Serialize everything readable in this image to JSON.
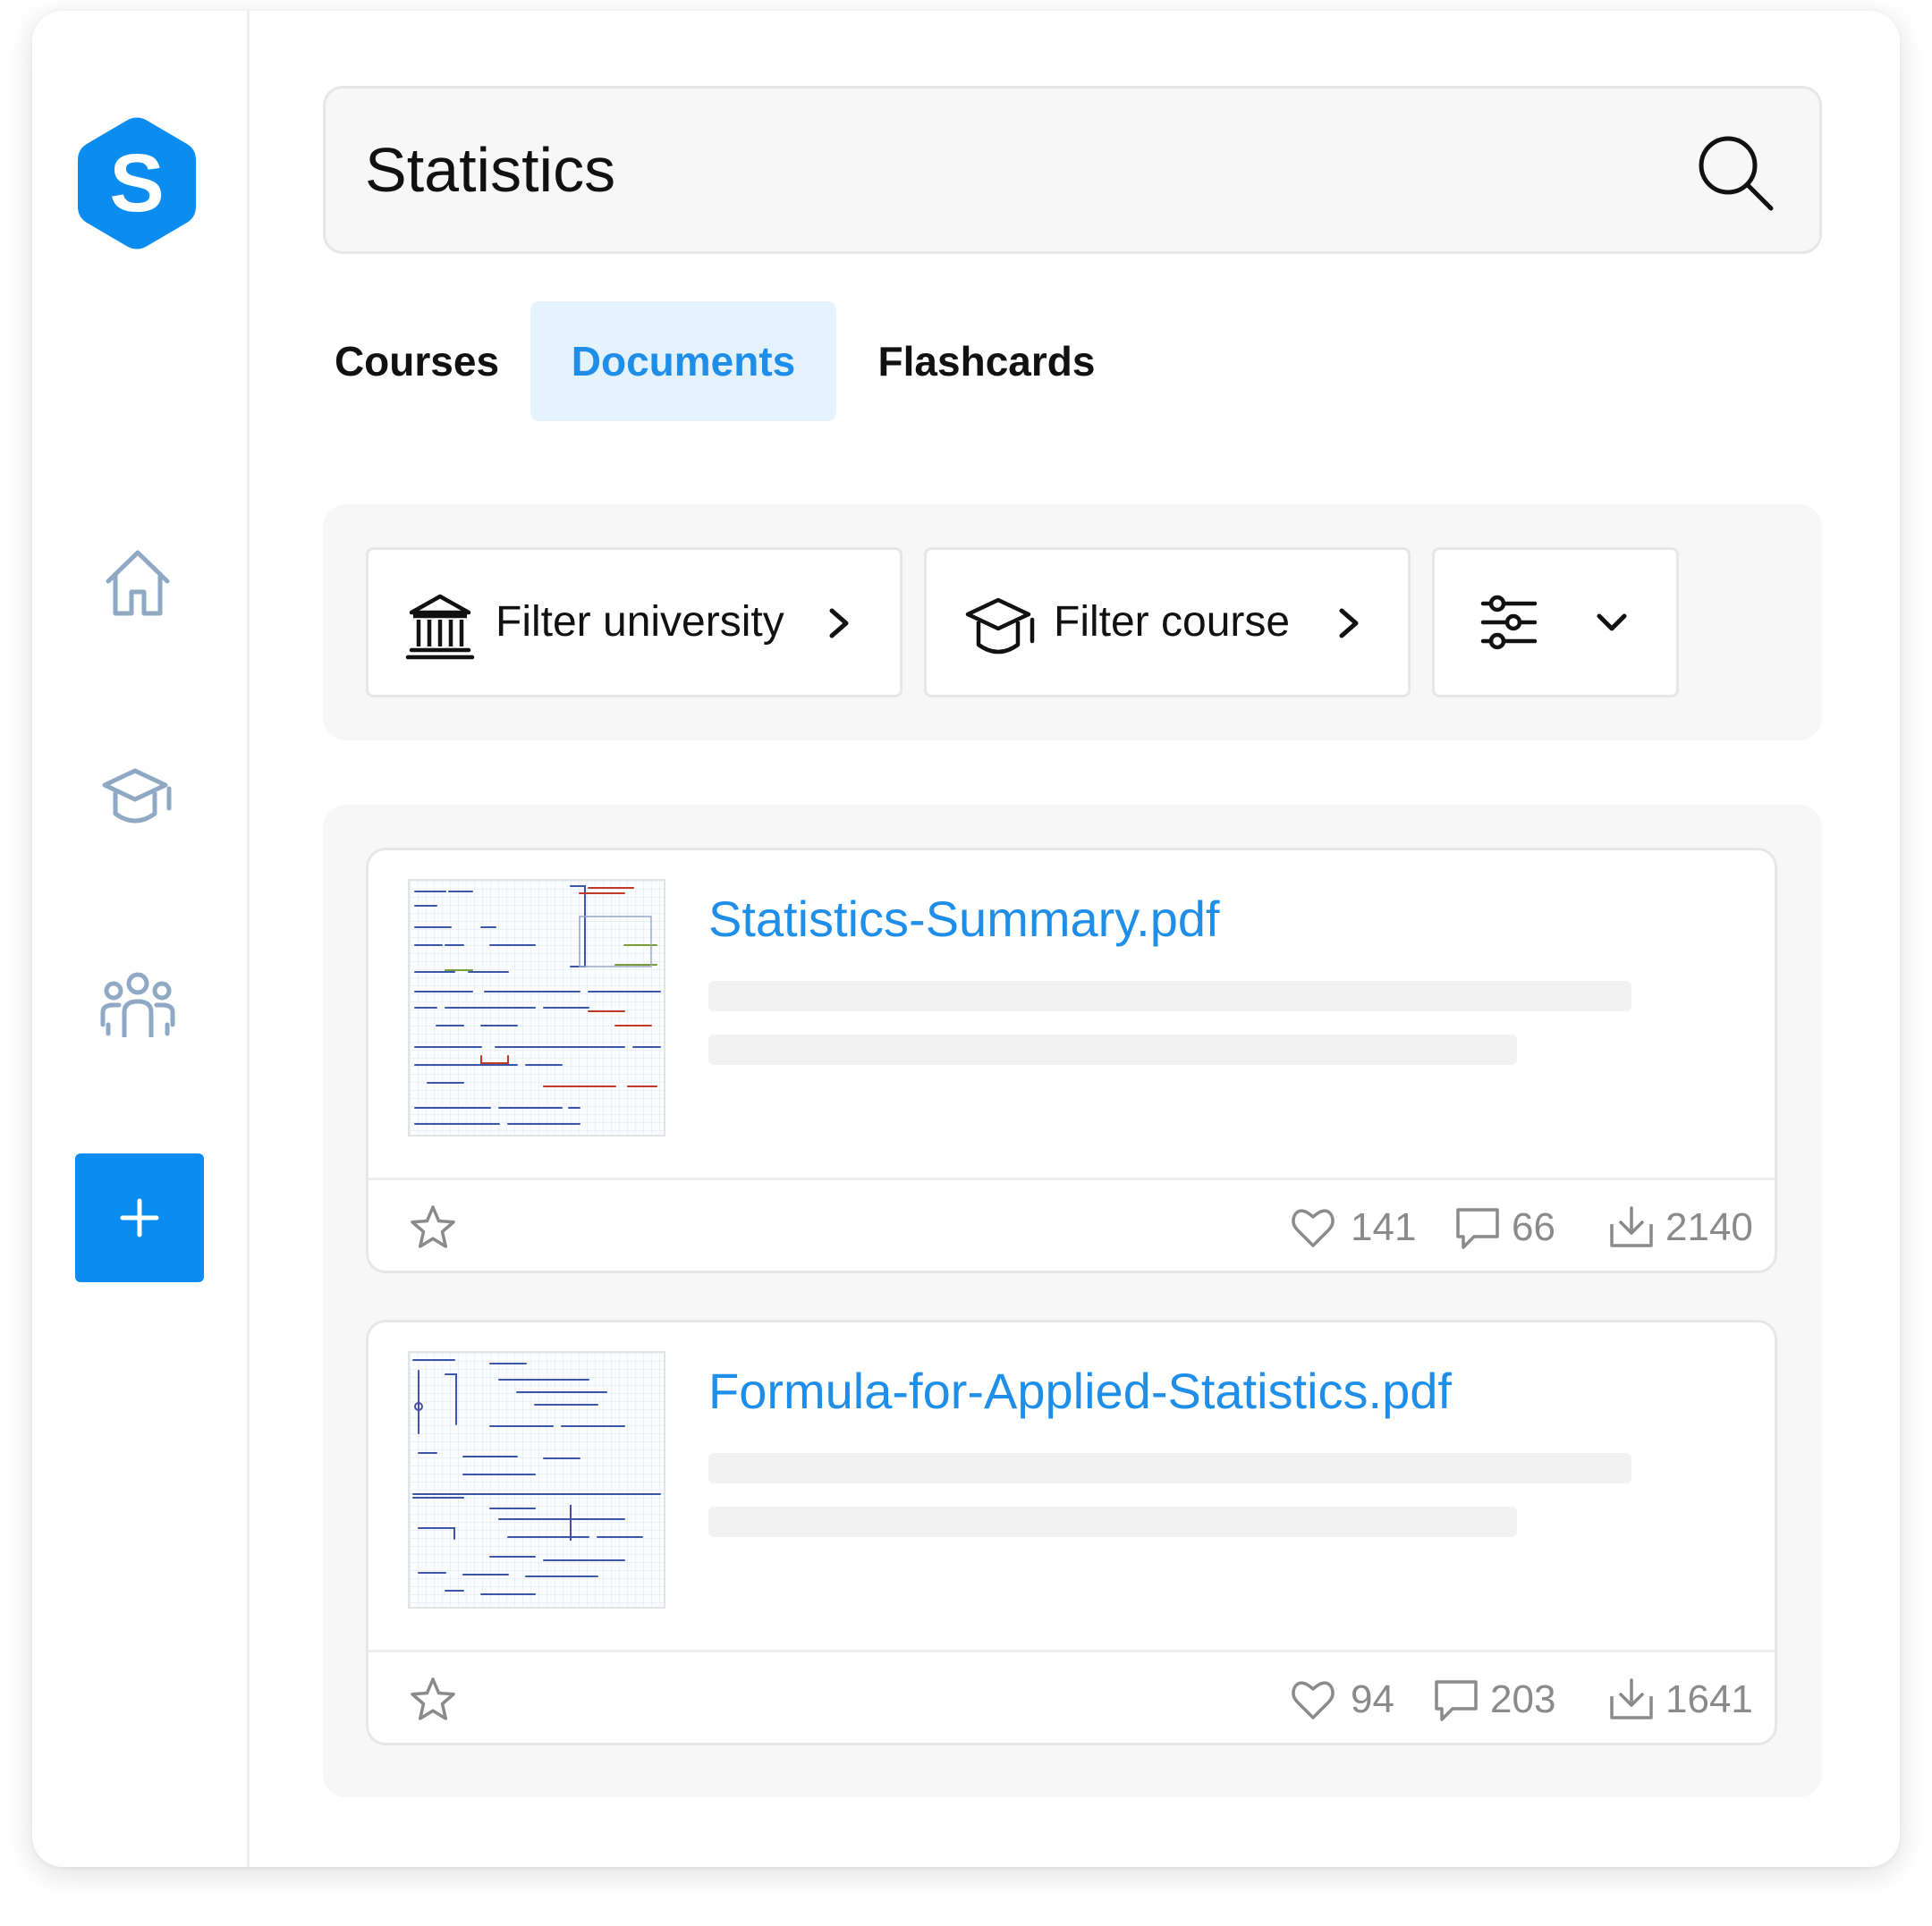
{
  "app": {
    "logo_letter": "S",
    "accent_color": "#0a8cf0",
    "link_color": "#1e8ee8"
  },
  "sidebar": {
    "items": [
      {
        "icon": "home-icon"
      },
      {
        "icon": "graduation-cap-icon"
      },
      {
        "icon": "people-group-icon"
      }
    ],
    "add_button": {
      "label": "+"
    }
  },
  "search": {
    "query": "Statistics",
    "icon": "search-icon"
  },
  "tabs": [
    {
      "label": "Courses",
      "active": false
    },
    {
      "label": "Documents",
      "active": true
    },
    {
      "label": "Flashcards",
      "active": false
    }
  ],
  "filters": {
    "university": {
      "label": "Filter university",
      "icon": "university-building-icon"
    },
    "course": {
      "label": "Filter course",
      "icon": "graduation-cap-icon"
    },
    "options": {
      "icon": "sliders-icon"
    }
  },
  "documents": [
    {
      "title": "Statistics-Summary.pdf",
      "likes": "141",
      "comments": "66",
      "downloads": "2140"
    },
    {
      "title": "Formula-for-Applied-Statistics.pdf",
      "likes": "94",
      "comments": "203",
      "downloads": "1641"
    }
  ]
}
